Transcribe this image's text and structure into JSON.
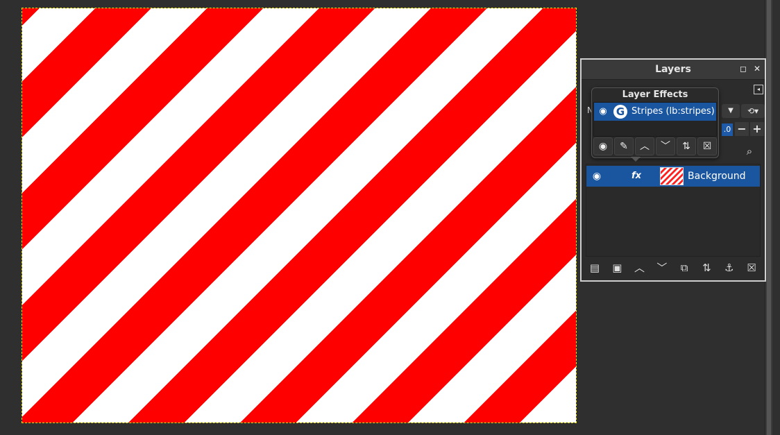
{
  "canvas": {
    "stripe_colors": [
      "#ff0000",
      "#ffffff"
    ],
    "selection_color": "#e8e400"
  },
  "layers_dock": {
    "title": "Layers",
    "icons": {
      "detach": "detach-icon",
      "close": "close-icon",
      "tab_menu": "tab-menu-icon"
    },
    "mode_label": "N",
    "opacity_value": ".0",
    "layers": [
      {
        "name": "Background",
        "visible": true,
        "has_effects": true,
        "fx_label": "fx"
      }
    ],
    "footer_buttons": [
      {
        "name": "new-layer",
        "glyph": "▤"
      },
      {
        "name": "new-layer-group",
        "glyph": "▣"
      },
      {
        "name": "raise-layer",
        "glyph": "︿"
      },
      {
        "name": "lower-layer",
        "glyph": "﹀"
      },
      {
        "name": "duplicate-layer",
        "glyph": "⧉"
      },
      {
        "name": "merge-layer",
        "glyph": "⇅"
      },
      {
        "name": "anchor-layer",
        "glyph": "⚓"
      },
      {
        "name": "delete-layer",
        "glyph": "☒"
      }
    ]
  },
  "layer_effects": {
    "title": "Layer Effects",
    "effects": [
      {
        "name": "Stripes (lb:stripes)",
        "visible": true,
        "icon_letter": "G"
      }
    ],
    "tools": [
      {
        "name": "toggle-visibility",
        "glyph": "◉"
      },
      {
        "name": "edit-effect",
        "glyph": "✎"
      },
      {
        "name": "raise-effect",
        "glyph": "︿"
      },
      {
        "name": "lower-effect",
        "glyph": "﹀"
      },
      {
        "name": "merge-effects",
        "glyph": "⇅"
      },
      {
        "name": "delete-effect",
        "glyph": "☒"
      }
    ]
  }
}
